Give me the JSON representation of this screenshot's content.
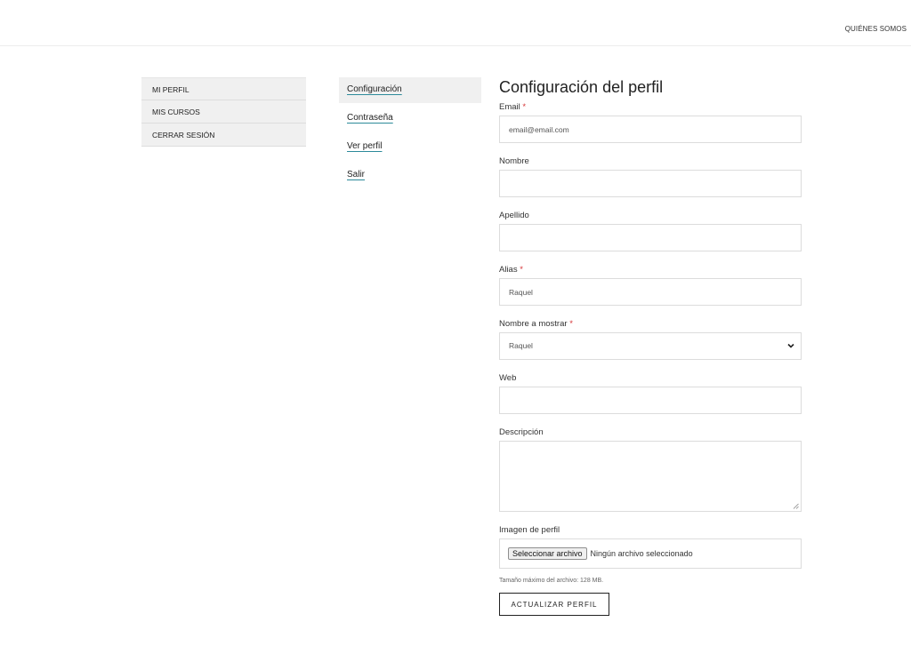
{
  "header": {
    "nav_link": "QUIÉNES SOMOS"
  },
  "account_menu": {
    "items": [
      {
        "label": "MI PERFIL"
      },
      {
        "label": "MIS CURSOS"
      },
      {
        "label": "CERRAR SESIÓN"
      }
    ]
  },
  "profile_menu": {
    "items": [
      {
        "label": "Configuración",
        "active": true
      },
      {
        "label": "Contraseña"
      },
      {
        "label": "Ver perfil"
      },
      {
        "label": "Salir"
      }
    ]
  },
  "form": {
    "title": "Configuración del perfil",
    "required_mark": "*",
    "email": {
      "label": "Email",
      "value": "email@email.com",
      "required": true
    },
    "first_name": {
      "label": "Nombre",
      "value": ""
    },
    "last_name": {
      "label": "Apellido",
      "value": ""
    },
    "nickname": {
      "label": "Alias",
      "value": "Raquel",
      "required": true
    },
    "display_name": {
      "label": "Nombre a mostrar",
      "selected": "Raquel",
      "required": true
    },
    "website": {
      "label": "Web",
      "value": ""
    },
    "description": {
      "label": "Descripción",
      "value": ""
    },
    "avatar": {
      "label": "Imagen de perfil",
      "button_label": "Seleccionar archivo",
      "status": "Ningún archivo seleccionado",
      "hint": "Tamaño máximo del archivo: 128 MB."
    },
    "submit_label": "ACTUALIZAR PERFIL"
  }
}
